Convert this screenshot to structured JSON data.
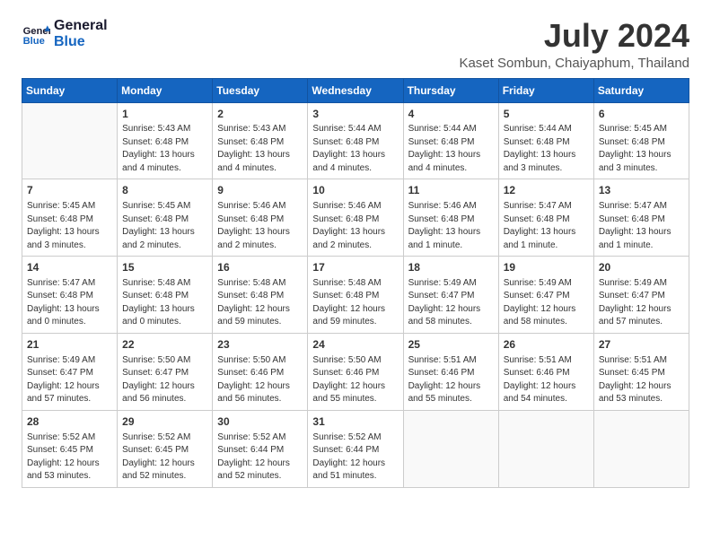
{
  "header": {
    "logo_line1": "General",
    "logo_line2": "Blue",
    "month_title": "July 2024",
    "location": "Kaset Sombun, Chaiyaphum, Thailand"
  },
  "weekdays": [
    "Sunday",
    "Monday",
    "Tuesday",
    "Wednesday",
    "Thursday",
    "Friday",
    "Saturday"
  ],
  "weeks": [
    [
      {
        "day": "",
        "info": ""
      },
      {
        "day": "1",
        "info": "Sunrise: 5:43 AM\nSunset: 6:48 PM\nDaylight: 13 hours\nand 4 minutes."
      },
      {
        "day": "2",
        "info": "Sunrise: 5:43 AM\nSunset: 6:48 PM\nDaylight: 13 hours\nand 4 minutes."
      },
      {
        "day": "3",
        "info": "Sunrise: 5:44 AM\nSunset: 6:48 PM\nDaylight: 13 hours\nand 4 minutes."
      },
      {
        "day": "4",
        "info": "Sunrise: 5:44 AM\nSunset: 6:48 PM\nDaylight: 13 hours\nand 4 minutes."
      },
      {
        "day": "5",
        "info": "Sunrise: 5:44 AM\nSunset: 6:48 PM\nDaylight: 13 hours\nand 3 minutes."
      },
      {
        "day": "6",
        "info": "Sunrise: 5:45 AM\nSunset: 6:48 PM\nDaylight: 13 hours\nand 3 minutes."
      }
    ],
    [
      {
        "day": "7",
        "info": "Sunrise: 5:45 AM\nSunset: 6:48 PM\nDaylight: 13 hours\nand 3 minutes."
      },
      {
        "day": "8",
        "info": "Sunrise: 5:45 AM\nSunset: 6:48 PM\nDaylight: 13 hours\nand 2 minutes."
      },
      {
        "day": "9",
        "info": "Sunrise: 5:46 AM\nSunset: 6:48 PM\nDaylight: 13 hours\nand 2 minutes."
      },
      {
        "day": "10",
        "info": "Sunrise: 5:46 AM\nSunset: 6:48 PM\nDaylight: 13 hours\nand 2 minutes."
      },
      {
        "day": "11",
        "info": "Sunrise: 5:46 AM\nSunset: 6:48 PM\nDaylight: 13 hours\nand 1 minute."
      },
      {
        "day": "12",
        "info": "Sunrise: 5:47 AM\nSunset: 6:48 PM\nDaylight: 13 hours\nand 1 minute."
      },
      {
        "day": "13",
        "info": "Sunrise: 5:47 AM\nSunset: 6:48 PM\nDaylight: 13 hours\nand 1 minute."
      }
    ],
    [
      {
        "day": "14",
        "info": "Sunrise: 5:47 AM\nSunset: 6:48 PM\nDaylight: 13 hours\nand 0 minutes."
      },
      {
        "day": "15",
        "info": "Sunrise: 5:48 AM\nSunset: 6:48 PM\nDaylight: 13 hours\nand 0 minutes."
      },
      {
        "day": "16",
        "info": "Sunrise: 5:48 AM\nSunset: 6:48 PM\nDaylight: 12 hours\nand 59 minutes."
      },
      {
        "day": "17",
        "info": "Sunrise: 5:48 AM\nSunset: 6:48 PM\nDaylight: 12 hours\nand 59 minutes."
      },
      {
        "day": "18",
        "info": "Sunrise: 5:49 AM\nSunset: 6:47 PM\nDaylight: 12 hours\nand 58 minutes."
      },
      {
        "day": "19",
        "info": "Sunrise: 5:49 AM\nSunset: 6:47 PM\nDaylight: 12 hours\nand 58 minutes."
      },
      {
        "day": "20",
        "info": "Sunrise: 5:49 AM\nSunset: 6:47 PM\nDaylight: 12 hours\nand 57 minutes."
      }
    ],
    [
      {
        "day": "21",
        "info": "Sunrise: 5:49 AM\nSunset: 6:47 PM\nDaylight: 12 hours\nand 57 minutes."
      },
      {
        "day": "22",
        "info": "Sunrise: 5:50 AM\nSunset: 6:47 PM\nDaylight: 12 hours\nand 56 minutes."
      },
      {
        "day": "23",
        "info": "Sunrise: 5:50 AM\nSunset: 6:46 PM\nDaylight: 12 hours\nand 56 minutes."
      },
      {
        "day": "24",
        "info": "Sunrise: 5:50 AM\nSunset: 6:46 PM\nDaylight: 12 hours\nand 55 minutes."
      },
      {
        "day": "25",
        "info": "Sunrise: 5:51 AM\nSunset: 6:46 PM\nDaylight: 12 hours\nand 55 minutes."
      },
      {
        "day": "26",
        "info": "Sunrise: 5:51 AM\nSunset: 6:46 PM\nDaylight: 12 hours\nand 54 minutes."
      },
      {
        "day": "27",
        "info": "Sunrise: 5:51 AM\nSunset: 6:45 PM\nDaylight: 12 hours\nand 53 minutes."
      }
    ],
    [
      {
        "day": "28",
        "info": "Sunrise: 5:52 AM\nSunset: 6:45 PM\nDaylight: 12 hours\nand 53 minutes."
      },
      {
        "day": "29",
        "info": "Sunrise: 5:52 AM\nSunset: 6:45 PM\nDaylight: 12 hours\nand 52 minutes."
      },
      {
        "day": "30",
        "info": "Sunrise: 5:52 AM\nSunset: 6:44 PM\nDaylight: 12 hours\nand 52 minutes."
      },
      {
        "day": "31",
        "info": "Sunrise: 5:52 AM\nSunset: 6:44 PM\nDaylight: 12 hours\nand 51 minutes."
      },
      {
        "day": "",
        "info": ""
      },
      {
        "day": "",
        "info": ""
      },
      {
        "day": "",
        "info": ""
      }
    ]
  ]
}
